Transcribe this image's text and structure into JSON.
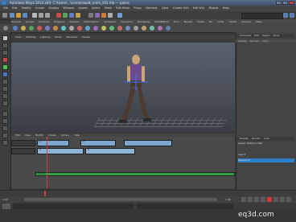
{
  "window": {
    "title": "Autodesk Maya 2014 x64: C:\\Users\\...\\scenes\\walk_anim_v01.mb --- pelvis"
  },
  "menubar": [
    "File",
    "Edit",
    "Modify",
    "Create",
    "Display",
    "Window",
    "Assets",
    "Select",
    "Mesh",
    "Edit Mesh",
    "Proxy",
    "Normals",
    "Color",
    "Create UVs",
    "Edit UVs",
    "Muscle",
    "Help"
  ],
  "shelf_tabs": [
    "General",
    "Curves",
    "Surfaces",
    "Polygons",
    "Subdivs",
    "Deformation",
    "Animation",
    "Dynamics",
    "Rendering",
    "PaintEffects",
    "Toon",
    "Muscle",
    "Fluids",
    "Fur",
    "nHair",
    "nCloth",
    "Custom",
    "XGen"
  ],
  "viewport_menu": [
    "View",
    "Shading",
    "Lighting",
    "Show",
    "Renderer",
    "Panels"
  ],
  "channel_box": {
    "header": [
      "Channels",
      "Edit",
      "Object",
      "Show"
    ],
    "tabs": [
      "Display",
      "Render",
      "Anim"
    ]
  },
  "graph_menu": [
    "Edit",
    "View",
    "Modify",
    "Create",
    "Library",
    "Help"
  ],
  "trax": {
    "tracks": [
      {
        "label": "",
        "clips": [
          {
            "label": "1",
            "color": "#7ea7cf"
          },
          {
            "label": "2",
            "color": "#7ea7cf"
          },
          {
            "label": "",
            "color": "#7ea7cf"
          }
        ]
      },
      {
        "label": "",
        "clips": [
          {
            "label": "1",
            "color": "#8eb4d8"
          },
          {
            "label": "2",
            "color": "#8eb4d8"
          }
        ]
      },
      {
        "label": "",
        "clips": [
          {
            "label": "Sound",
            "color": "#34a34a"
          }
        ]
      }
    ]
  },
  "layers": {
    "tabs": [
      "Display",
      "Render",
      "Anim"
    ],
    "rows": [
      "Layers",
      "Options",
      "Help",
      "layer1",
      "BaseAnim"
    ]
  },
  "colors": {
    "accent": "#2d7fc8",
    "clip_blue": "#7ea7cf",
    "sound_green": "#34a34a",
    "playhead": "#d83a3a"
  },
  "timeslider": {
    "start": "1.00",
    "end": "1.00"
  },
  "watermark": "eq3d.com"
}
